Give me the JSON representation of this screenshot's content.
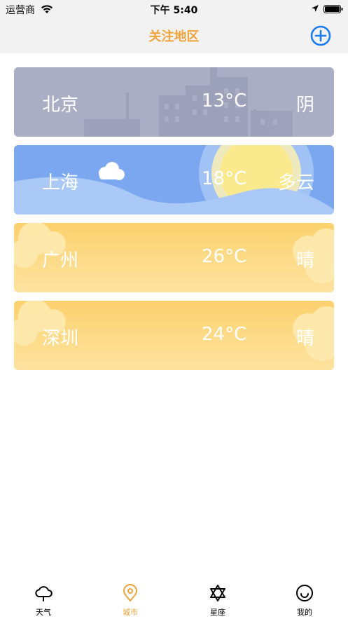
{
  "status_bar": {
    "carrier": "运营商",
    "time": "下午 5:40"
  },
  "nav": {
    "title": "关注地区"
  },
  "cities": [
    {
      "name": "北京",
      "temp": "13°C",
      "condition": "阴"
    },
    {
      "name": "上海",
      "temp": "18°C",
      "condition": "多云"
    },
    {
      "name": "广州",
      "temp": "26°C",
      "condition": "晴"
    },
    {
      "name": "深圳",
      "temp": "24°C",
      "condition": "晴"
    }
  ],
  "tabs": [
    {
      "label": "天气",
      "icon": "cloud-icon"
    },
    {
      "label": "城市",
      "icon": "location-pin-icon",
      "active": true
    },
    {
      "label": "星座",
      "icon": "star-of-david-icon"
    },
    {
      "label": "我的",
      "icon": "smiley-icon"
    }
  ],
  "colors": {
    "accent": "#f0a33a",
    "add_button": "#1a7cf0",
    "cloudy": "#a9aec5",
    "partly_cloudy": "#7aa7f0",
    "sunny": "#fbd579"
  }
}
